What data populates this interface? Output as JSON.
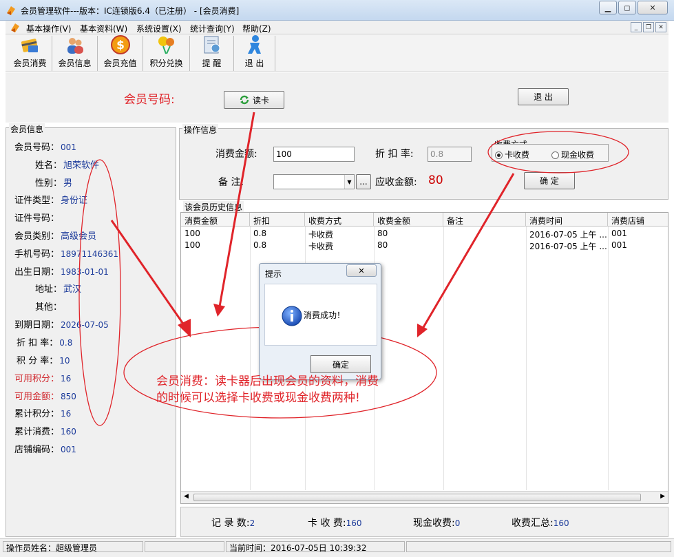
{
  "window": {
    "title": "会员管理软件---版本：IC连锁版6.4（已注册） - [会员消费]",
    "minimize_icon": "minimize-icon",
    "maximize_icon": "maximize-icon",
    "close_icon": "close-icon"
  },
  "menu": {
    "items": [
      "基本操作(V)",
      "基本资料(W)",
      "系统设置(X)",
      "统计查询(Y)",
      "帮助(Z)"
    ]
  },
  "toolbar": {
    "items": [
      {
        "label": "会员消费",
        "icon": "card-payment-icon"
      },
      {
        "label": "会员信息",
        "icon": "members-icon"
      },
      {
        "label": "会员充值",
        "icon": "dollar-coin-icon"
      },
      {
        "label": "积分兑换",
        "icon": "gift-balloon-icon"
      },
      {
        "label": "提 醒",
        "icon": "reminder-icon"
      },
      {
        "label": "退 出",
        "icon": "exit-person-icon"
      }
    ]
  },
  "read_card": {
    "member_no_label": "会员号码:",
    "read_button": "读卡",
    "exit_button": "退 出"
  },
  "member_info": {
    "title": "会员信息",
    "rows": [
      {
        "label": "会员号码：",
        "value": "001"
      },
      {
        "label": "姓名：",
        "value": "旭荣软件"
      },
      {
        "label": "性别：",
        "value": "男"
      },
      {
        "label": "证件类型：",
        "value": "身份证"
      },
      {
        "label": "证件号码：",
        "value": ""
      },
      {
        "label": "会员类别：",
        "value": "高级会员"
      },
      {
        "label": "手机号码：",
        "value": "18971146361"
      },
      {
        "label": "出生日期：",
        "value": "1983-01-01"
      },
      {
        "label": "地址：",
        "value": "武汉"
      },
      {
        "label": "其他：",
        "value": ""
      },
      {
        "label": "到期日期：",
        "value": "2026-07-05"
      },
      {
        "label": "折 扣 率：",
        "value": "0.8"
      },
      {
        "label": "积 分 率：",
        "value": "10"
      },
      {
        "label": "可用积分：",
        "value": "16"
      },
      {
        "label": "可用金额：",
        "value": "850"
      },
      {
        "label": "累计积分：",
        "value": "16"
      },
      {
        "label": "累计消费：",
        "value": "160"
      },
      {
        "label": "店铺编码：",
        "value": "001"
      }
    ]
  },
  "operation": {
    "title": "操作信息",
    "amount_label": "消费金额:",
    "amount_value": "100",
    "discount_label": "折 扣 率:",
    "discount_value": "0.8",
    "payment_group_label": "收费方式",
    "payment_card": "卡收费",
    "payment_cash": "现金收费",
    "remark_label": "备    注:",
    "remark_value": "",
    "browse_button": "...",
    "receivable_label": "应收金额:",
    "receivable_value": "80",
    "confirm_button": "确 定"
  },
  "history": {
    "title": "该会员历史信息",
    "columns": [
      "消费金额",
      "折扣",
      "收费方式",
      "收费金额",
      "备注",
      "消费时间",
      "消费店铺"
    ],
    "rows": [
      [
        "100",
        "0.8",
        "卡收费",
        "80",
        "",
        "2016-07-05 上午 ...",
        "001"
      ],
      [
        "100",
        "0.8",
        "卡收费",
        "80",
        "",
        "2016-07-05 上午 ...",
        "001"
      ]
    ]
  },
  "summary": {
    "records_label": "记 录 数:",
    "records_value": "2",
    "card_label": "卡 收 费:",
    "card_value": "160",
    "cash_label": "现金收费:",
    "cash_value": "0",
    "total_label": "收费汇总:",
    "total_value": "160"
  },
  "status": {
    "operator": "操作员姓名：超级管理员",
    "time": "当前时间：2016-07-05日 10:39:32"
  },
  "dialog": {
    "title": "提示",
    "message": "消费成功！",
    "ok_button": "确定",
    "icon": "info-icon"
  },
  "annotation": {
    "line1": "会员消费：读卡器后出现会员的资料，消费",
    "line2": "的时候可以选择卡收费或现金收费两种!"
  },
  "colors": {
    "accent_red": "#e0242a",
    "value_blue": "#1b3a9a"
  }
}
